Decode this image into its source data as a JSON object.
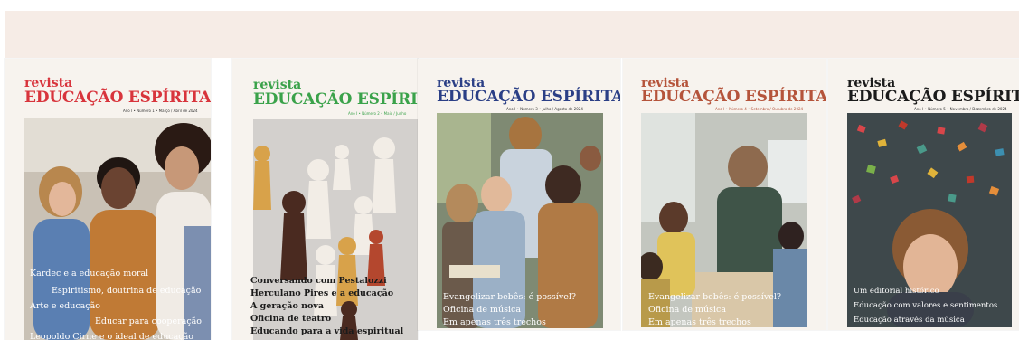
{
  "colors": {
    "band": "#f6ece6",
    "cover_red": "#d8343c",
    "cover_green": "#3aa24a",
    "cover_blue": "#2b3f86",
    "cover_rust": "#b5543b",
    "cover_black": "#1b1b1b"
  },
  "covers": [
    {
      "revista": "revista",
      "title": "EDUCAÇÃO ESPÍRITA",
      "issue": "Ano I • Número 1 • Março / Abril de 2024",
      "headlines": [
        "Kardec e a educação moral",
        "Espiritismo, doutrina de educação",
        "Arte e educação",
        "Educar para cooperação",
        "Leopoldo Cirne e o ideal de educação"
      ]
    },
    {
      "revista": "revista",
      "title": "EDUCAÇÃO ESPÍRITA",
      "issue": "Ano I • Número 2 • Maio / Junho",
      "headlines": [
        "Conversando com Pestalozzi",
        "Herculano Pires e a educação",
        "A geração nova",
        "Oficina de teatro",
        "Educando para a vida espiritual"
      ]
    },
    {
      "revista": "revista",
      "title": "EDUCAÇÃO ESPÍRITA",
      "issue": "Ano I • Número 3 • Julho / Agosto de 2024",
      "headlines": [
        "Evangelizar bebês: é possível?",
        "Oficina de música",
        "Em apenas três trechos"
      ]
    },
    {
      "revista": "revista",
      "title": "EDUCAÇÃO ESPÍRITA",
      "issue": "Ano I • Número 4 • Setembro / Outubro de 2024",
      "headlines": [
        "Evangelizar bebês: é possível?",
        "Oficina de música",
        "Em apenas três trechos"
      ]
    },
    {
      "revista": "revista",
      "title": "EDUCAÇÃO ESPÍRITA",
      "issue": "Ano I • Número 5 • Novembro / Dezembro de 2024",
      "headlines": [
        "Um editorial histórico",
        "Educação com valores e sentimentos",
        "Educação através da música"
      ]
    }
  ]
}
